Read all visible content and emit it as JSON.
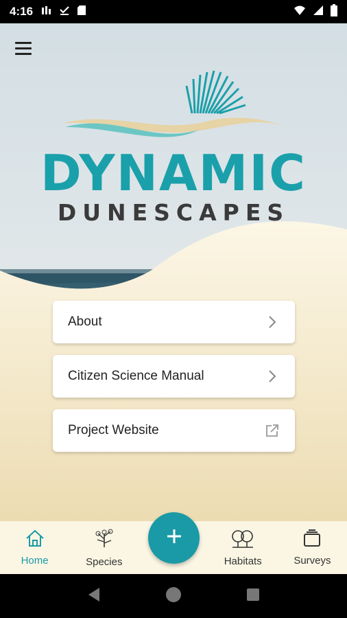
{
  "status_bar": {
    "time": "4:16",
    "left_icons": [
      "sim-icon",
      "download-done-icon",
      "sd-card-icon"
    ],
    "right_icons": [
      "wifi-icon",
      "signal-icon",
      "battery-icon"
    ]
  },
  "header": {
    "menu_icon": "hamburger-menu-icon",
    "logo_title": "DYNAMIC",
    "logo_subtitle": "DUNESCAPES"
  },
  "menu": {
    "items": [
      {
        "label": "About",
        "icon": "chevron-right-icon"
      },
      {
        "label": "Citizen Science Manual",
        "icon": "chevron-right-icon"
      },
      {
        "label": "Project Website",
        "icon": "external-link-icon"
      }
    ]
  },
  "bottom_nav": {
    "items": [
      {
        "label": "Home",
        "icon": "home-icon",
        "active": true
      },
      {
        "label": "Species",
        "icon": "plant-icon",
        "active": false
      },
      {
        "label": "Habitats",
        "icon": "trees-icon",
        "active": false
      },
      {
        "label": "Surveys",
        "icon": "layers-icon",
        "active": false
      }
    ],
    "fab_icon": "plus-icon"
  },
  "colors": {
    "accent": "#1a9aa6",
    "sand": "#f3ead0",
    "sky": "#dfe6ea",
    "subtitle": "#3a3a3a"
  },
  "system_nav": {
    "icons": [
      "back-icon",
      "home-circle-icon",
      "recents-icon"
    ]
  }
}
